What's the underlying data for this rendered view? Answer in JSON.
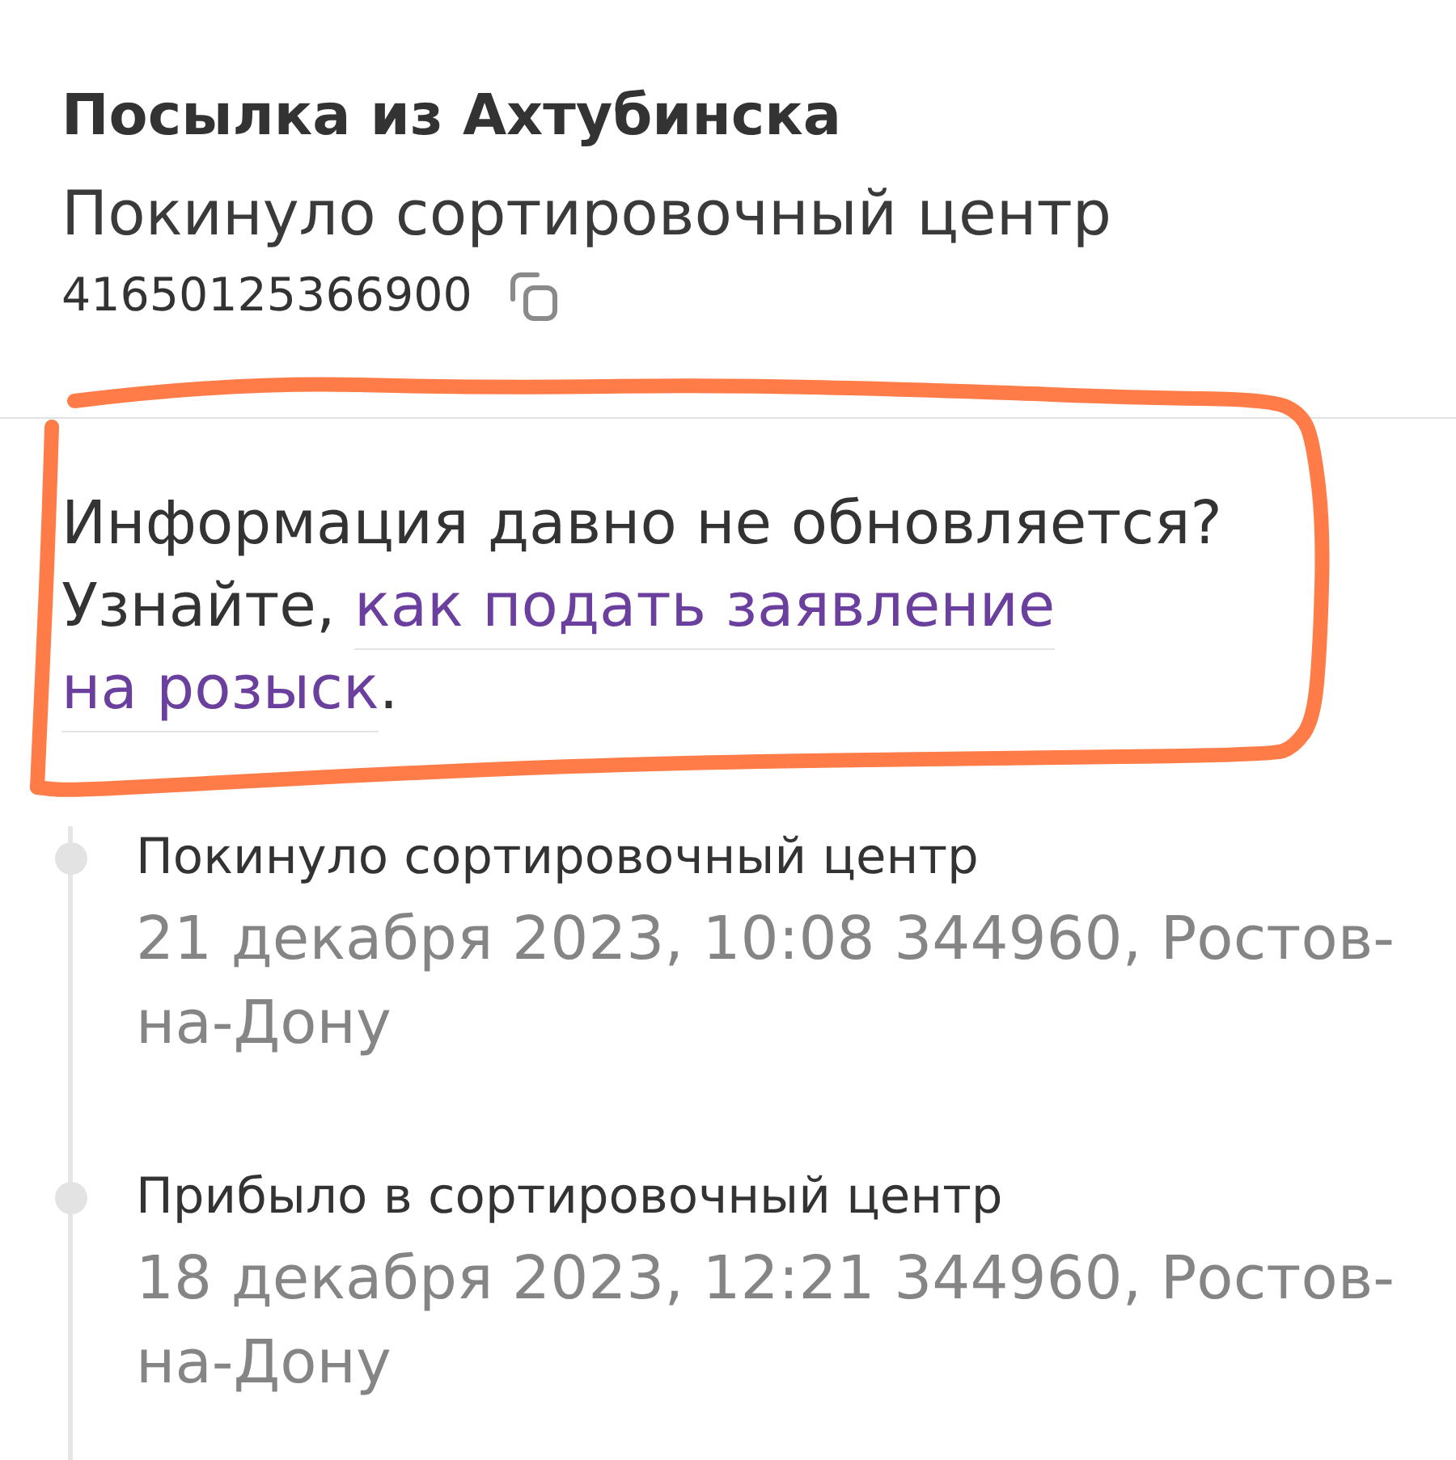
{
  "parcel": {
    "title": "Посылка из Ахтубинска",
    "status": "Покинуло сортировочный центр",
    "tracking_number": "41650125366900"
  },
  "notice": {
    "highlighted": true,
    "question": "Информация давно не обновляется?",
    "prompt": "Узнайте,",
    "link_lines": [
      "как подать заявление",
      "на розыск"
    ],
    "ending": "."
  },
  "events": [
    {
      "title": "Покинуло сортировочный центр",
      "details": "21 декабря 2023, 10:08 344960, Ростов-на-Дону"
    },
    {
      "title": "Прибыло в сортировочный центр",
      "details": "18 декабря 2023, 12:21 344960, Ростов-на-Дону"
    }
  ]
}
